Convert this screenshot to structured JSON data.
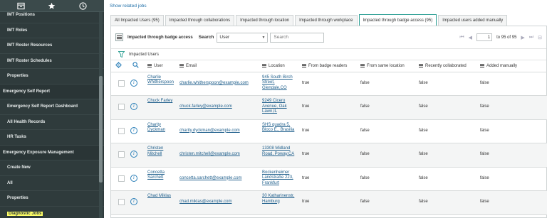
{
  "sidebar": {
    "items": [
      {
        "label": "IMT Positions",
        "type": "item"
      },
      {
        "label": "IMT Roles",
        "type": "item"
      },
      {
        "label": "IMT Roster Resources",
        "type": "item"
      },
      {
        "label": "IMT Roster Schedules",
        "type": "item"
      },
      {
        "label": "Properties",
        "type": "item"
      },
      {
        "label": "Emergency Self Report",
        "type": "section"
      },
      {
        "label": "Emergency Self Report Dashboard",
        "type": "item"
      },
      {
        "label": "All Health Records",
        "type": "item"
      },
      {
        "label": "HR Tasks",
        "type": "item"
      },
      {
        "label": "Emergency Exposure Management",
        "type": "section"
      },
      {
        "label": "Create New",
        "type": "item"
      },
      {
        "label": "All",
        "type": "item"
      },
      {
        "label": "Properties",
        "type": "item"
      },
      {
        "label": "Diagnostic Jobs",
        "type": "item",
        "highlight": true
      }
    ]
  },
  "main": {
    "show_related": "Show related jobs",
    "tabs": [
      {
        "label": "All Impacted Users (95)"
      },
      {
        "label": "Impacted through collaborations"
      },
      {
        "label": "Impacted through location"
      },
      {
        "label": "Impacted through workplace"
      },
      {
        "label": "Impacted through badge access (95)",
        "active": true
      },
      {
        "label": "Impacted users added manually"
      }
    ],
    "toolbar": {
      "title": "Impacted through badge access",
      "search_label": "Search",
      "field_value": "User",
      "search_placeholder": "Search",
      "page_value": "1",
      "page_of": "to 95 of 95"
    },
    "filter_label": "Impacted Users",
    "columns": [
      "User",
      "Email",
      "Location",
      "From badge readers",
      "From same location",
      "Recently collaborated",
      "Added manually"
    ],
    "rows": [
      {
        "user": "Charlie Whitherspoon",
        "email": "charlie.whitherspoon@example.com",
        "location": "945 South Birch Street, Glendale,CO",
        "badge": "true",
        "same": "false",
        "collab": "false",
        "manual": "false"
      },
      {
        "user": "Chuck Farley",
        "email": "chuck.farley@example.com",
        "location": "9249 Cicero Avenue, Oak Lawn,IL",
        "badge": "true",
        "same": "false",
        "collab": "false",
        "manual": "false"
      },
      {
        "user": "Charity Dyckman",
        "email": "charity.dyckman@example.com",
        "location": "SHS quadra 5, Bloco E., Brasilia",
        "badge": "true",
        "same": "false",
        "collab": "false",
        "manual": "false"
      },
      {
        "user": "Christen Mitchell",
        "email": "christen.mitchell@example.com",
        "location": "13308 Midland Road, Poway,CA",
        "badge": "true",
        "same": "false",
        "collab": "false",
        "manual": "false"
      },
      {
        "user": "Concetta Sarchett",
        "email": "concetta.sarchett@example.com",
        "location": "Bockenheimer Landstraße 223, Frankfurt",
        "badge": "true",
        "same": "false",
        "collab": "false",
        "manual": "false"
      },
      {
        "user": "Chad Miklas",
        "email": "chad.miklas@example.com",
        "location": "30 Katharinenstr, Hamburg",
        "badge": "true",
        "same": "false",
        "collab": "false",
        "manual": "false"
      }
    ]
  }
}
